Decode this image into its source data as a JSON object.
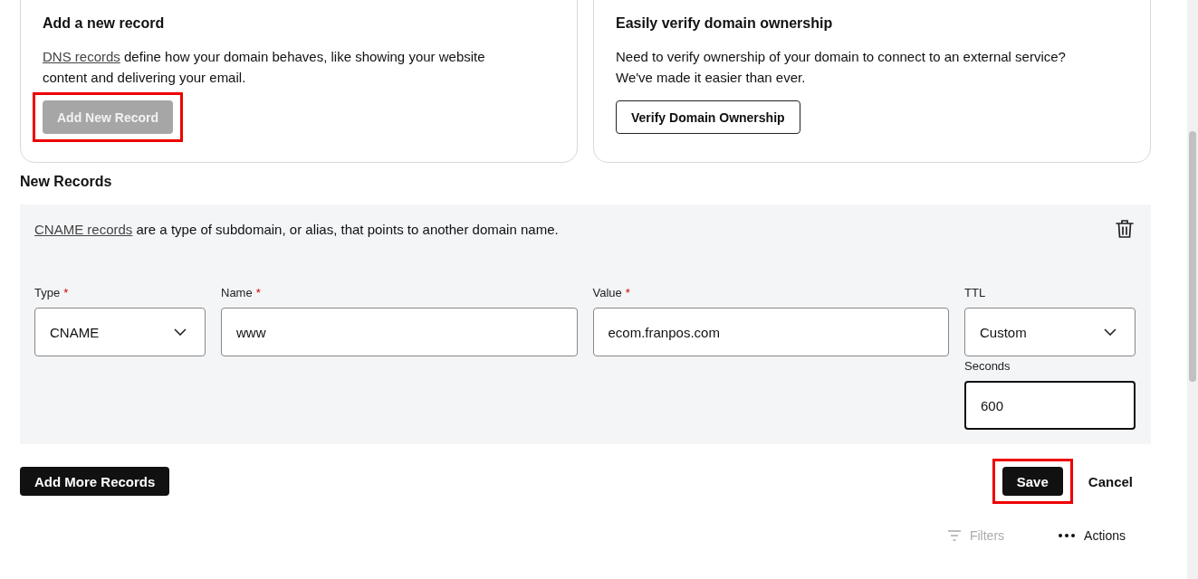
{
  "cards": [
    {
      "title": "Add a new record",
      "link": "DNS records",
      "text": " define how your domain behaves, like showing your website content and delivering your email.",
      "button": {
        "label": "Add New Record",
        "disabled": true,
        "highlighted": true
      }
    },
    {
      "title": "Easily verify domain ownership",
      "text": "Need to verify ownership of your domain to connect to an external service? We've made it easier than ever.",
      "button": {
        "label": "Verify Domain Ownership",
        "disabled": false,
        "highlighted": false
      }
    }
  ],
  "new_records": {
    "heading": "New Records",
    "link": "CNAME records",
    "text": " are a type of subdomain, or alias, that points to another domain name.",
    "fields": [
      {
        "kind": "select",
        "label": "Type",
        "required_mark": "*",
        "value": "CNAME"
      },
      {
        "kind": "text",
        "label": "Name",
        "required_mark": "*",
        "value": "www"
      },
      {
        "kind": "text",
        "label": "Value",
        "required_mark": "*",
        "value": "ecom.franpos.com"
      },
      {
        "kind": "select",
        "label": "TTL",
        "value": "Custom"
      }
    ],
    "seconds": {
      "label": "Seconds",
      "value": "600",
      "focused": true
    }
  },
  "footer": {
    "add_more": {
      "label": "Add More Records",
      "highlighted": false
    },
    "save": {
      "label": "Save",
      "highlighted": true
    },
    "cancel": {
      "label": "Cancel"
    }
  },
  "toolbar": {
    "filters": {
      "label": "Filters",
      "disabled": true
    },
    "actions": {
      "label": "Actions"
    }
  }
}
